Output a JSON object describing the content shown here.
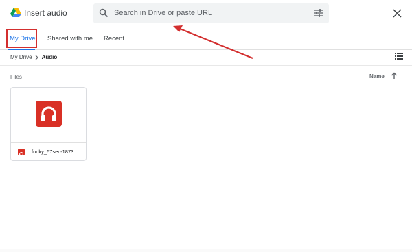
{
  "header": {
    "title": "Insert audio",
    "search_placeholder": "Search in Drive or paste URL"
  },
  "tabs": [
    {
      "label": "My Drive",
      "active": true
    },
    {
      "label": "Shared with me",
      "active": false
    },
    {
      "label": "Recent",
      "active": false
    }
  ],
  "breadcrumb": {
    "root": "My Drive",
    "current": "Audio"
  },
  "files": {
    "section_label": "Files",
    "sort_label": "Name",
    "items": [
      {
        "name": "funky_57sec-1873...",
        "type": "audio"
      }
    ]
  },
  "colors": {
    "accent": "#1a73e8",
    "audio_icon": "#d93025",
    "annotation": "#d32f2f"
  },
  "icons": [
    "drive-logo-icon",
    "search-icon",
    "tune-icon",
    "close-icon",
    "chevron-right-icon",
    "list-view-icon",
    "sort-up-arrow-icon",
    "headphones-icon"
  ]
}
